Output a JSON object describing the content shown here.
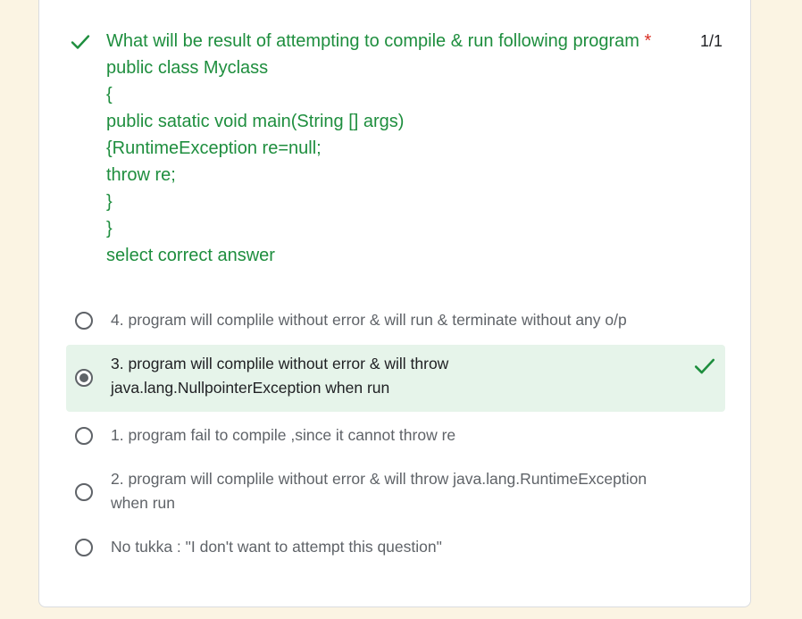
{
  "question": {
    "lines": [
      "What will be result of attempting to compile & run following program",
      "public class Myclass",
      "{",
      "public satatic void main(String [] args)",
      "{RuntimeException re=null;",
      "throw re;",
      "}",
      "}",
      "select correct answer"
    ],
    "required_marker": "*",
    "score": "1/1",
    "status_icon": "checkmark-icon",
    "status_color": "#1e8e3e"
  },
  "options": [
    {
      "label": "4. program will complile without error & will run & terminate without any o/p",
      "selected": false,
      "correct": false
    },
    {
      "label_line1": "3. program will complile without error & will throw",
      "label_line2": "java.lang.NullpointerException when run",
      "selected": true,
      "correct": true
    },
    {
      "label": "1. program fail to compile ,since it cannot throw re",
      "selected": false,
      "correct": false
    },
    {
      "label_line1": "2. program will complile without error & will throw java.lang.RuntimeException",
      "label_line2": "when run",
      "selected": false,
      "correct": false
    },
    {
      "label": "No tukka : \"I don't want to attempt this question\"",
      "selected": false,
      "correct": false
    }
  ],
  "colors": {
    "page_background": "#fbf4e3",
    "correct_green": "#1e8e3e",
    "correct_highlight": "#e6f4ea",
    "required_red": "#d93025"
  }
}
